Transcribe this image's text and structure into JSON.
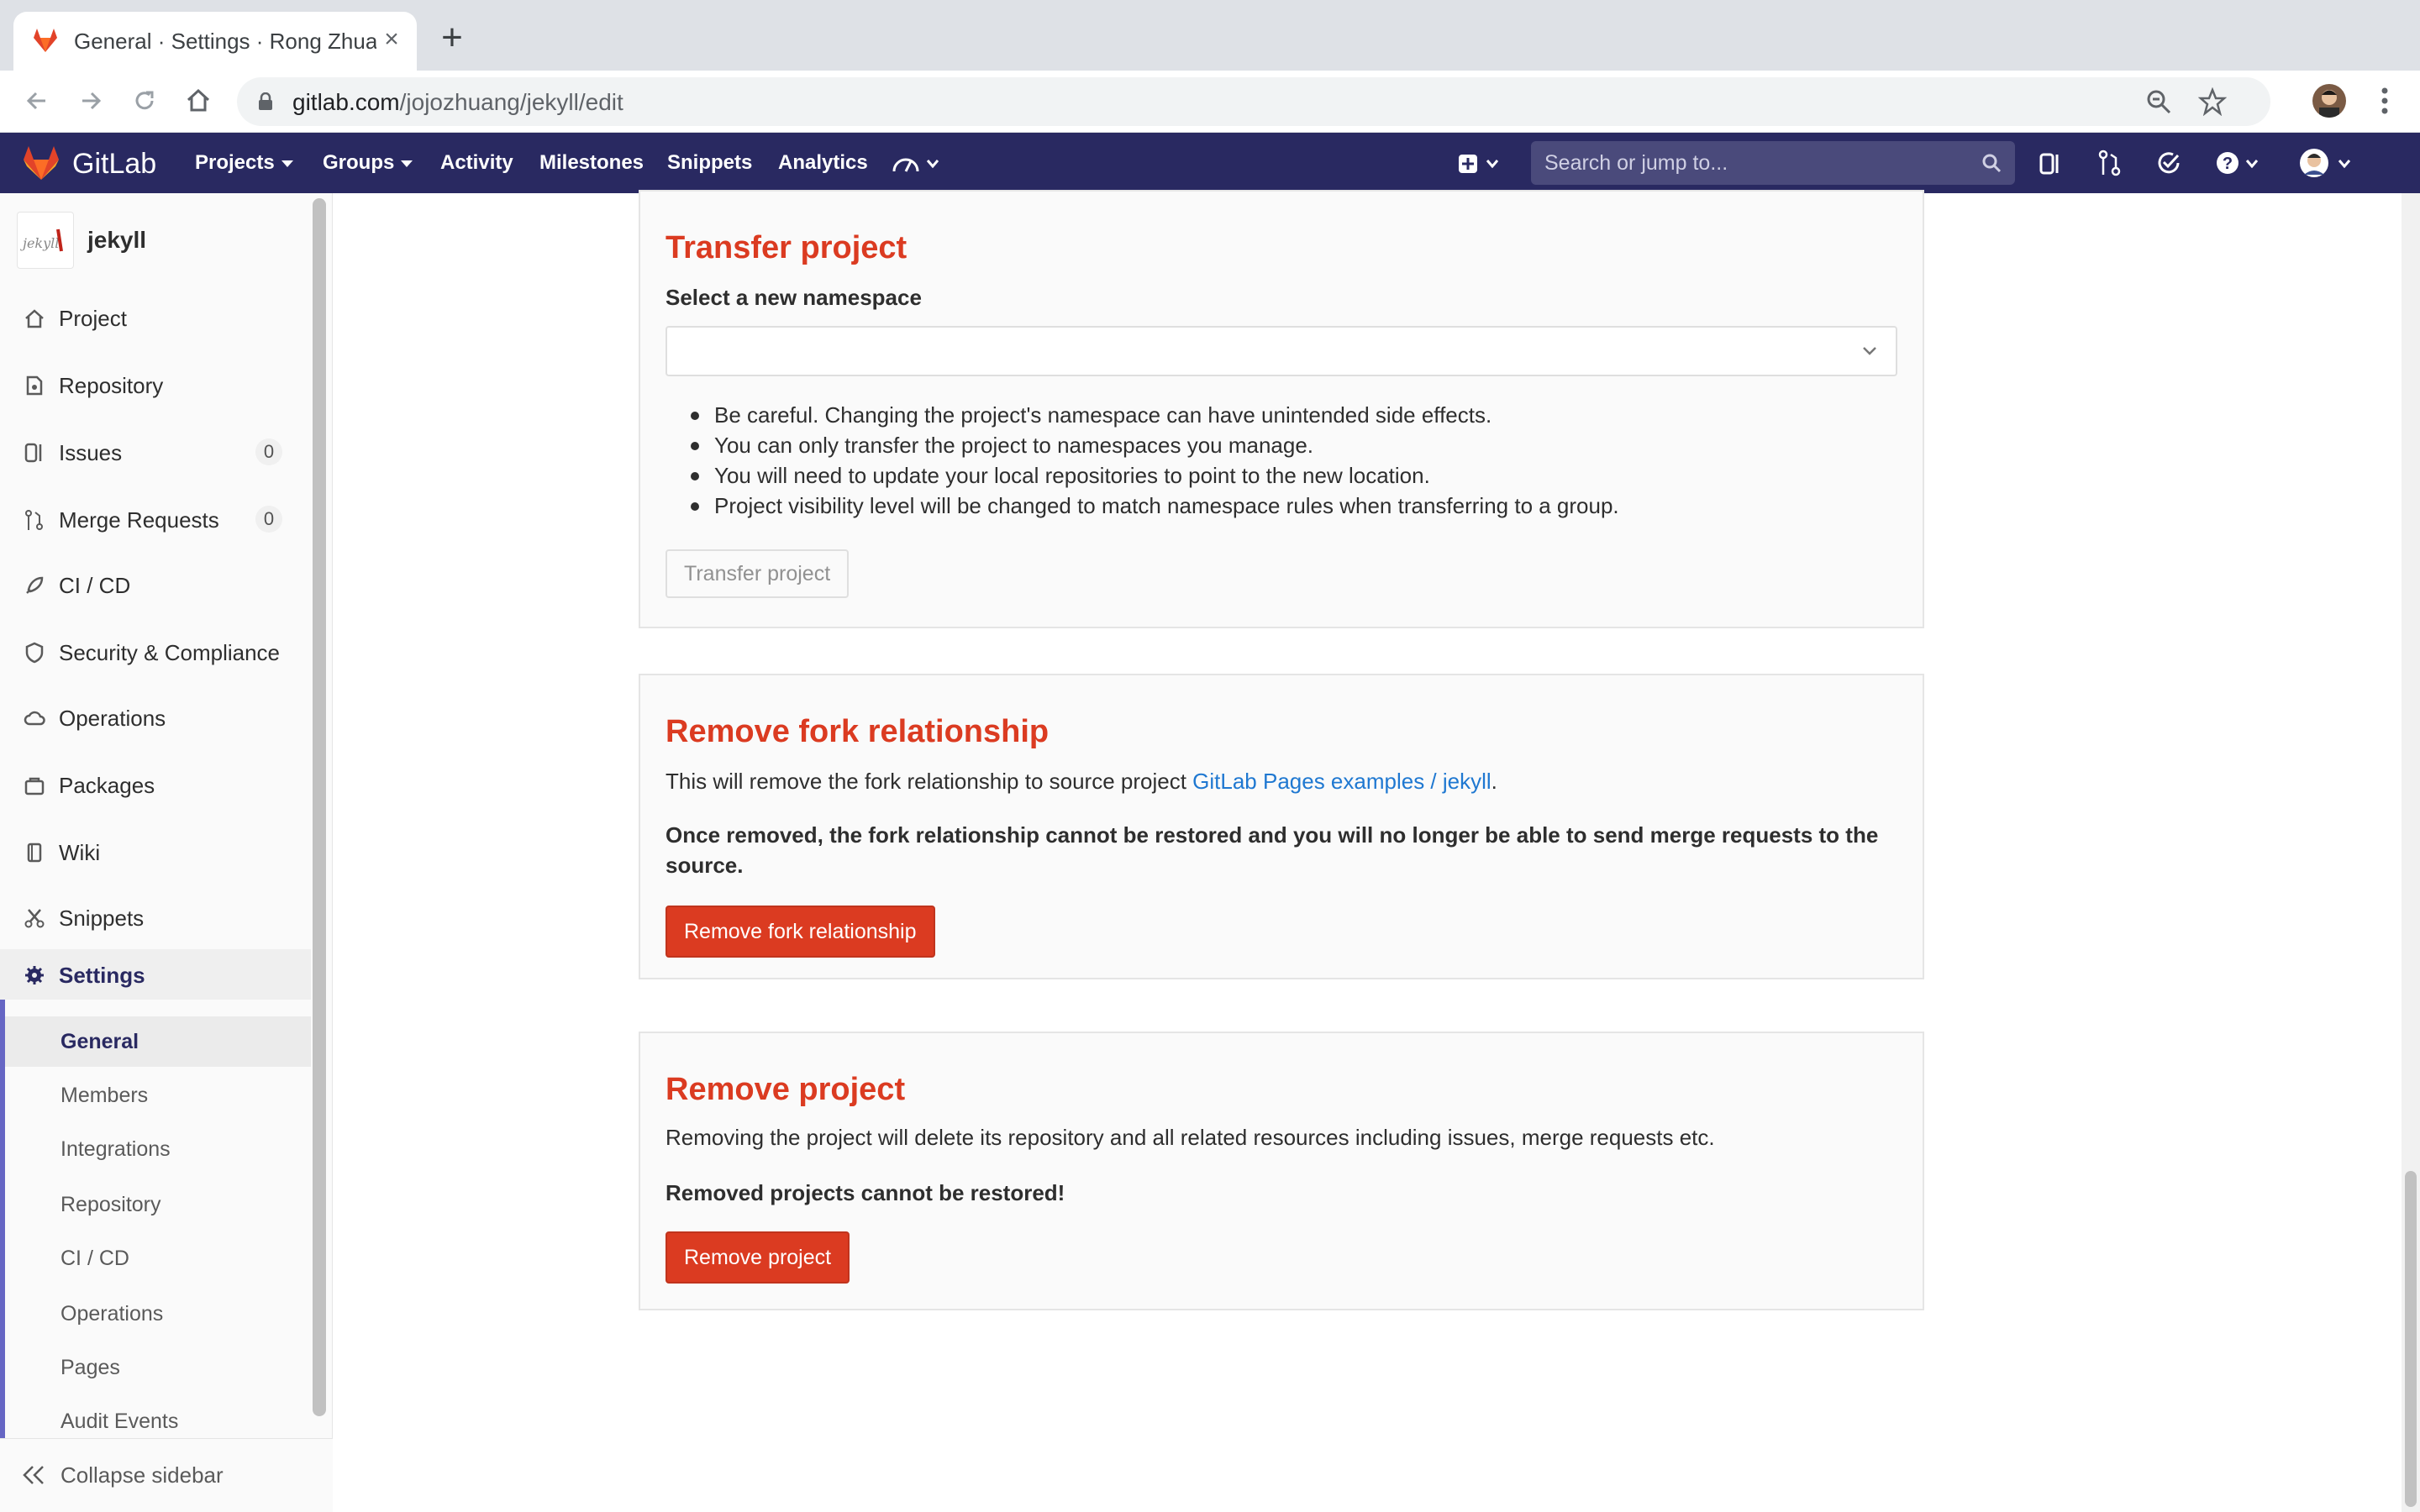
{
  "browser": {
    "tab_title": "General · Settings · Rong Zhuang",
    "url_host": "gitlab.com",
    "url_path": "/jojozhuang/jekyll/edit"
  },
  "gitlab_nav": {
    "brand": "GitLab",
    "links": [
      "Projects",
      "Groups",
      "Activity",
      "Milestones",
      "Snippets",
      "Analytics"
    ],
    "search_placeholder": "Search or jump to..."
  },
  "sidebar": {
    "project_name": "jekyll",
    "items": [
      {
        "label": "Project",
        "icon": "home-icon"
      },
      {
        "label": "Repository",
        "icon": "doc-icon"
      },
      {
        "label": "Issues",
        "icon": "issues-icon",
        "count": "0"
      },
      {
        "label": "Merge Requests",
        "icon": "merge-request-icon",
        "count": "0"
      },
      {
        "label": "CI / CD",
        "icon": "rocket-icon"
      },
      {
        "label": "Security & Compliance",
        "icon": "shield-icon"
      },
      {
        "label": "Operations",
        "icon": "cloud-icon"
      },
      {
        "label": "Packages",
        "icon": "package-icon"
      },
      {
        "label": "Wiki",
        "icon": "book-icon"
      },
      {
        "label": "Snippets",
        "icon": "scissors-icon"
      },
      {
        "label": "Settings",
        "icon": "gear-icon"
      }
    ],
    "settings_sub": [
      "General",
      "Members",
      "Integrations",
      "Repository",
      "CI / CD",
      "Operations",
      "Pages",
      "Audit Events"
    ],
    "active_sub": "General",
    "collapse_label": "Collapse sidebar"
  },
  "transfer": {
    "title": "Transfer project",
    "label": "Select a new namespace",
    "bullets": [
      "Be careful. Changing the project's namespace can have unintended side effects.",
      "You can only transfer the project to namespaces you manage.",
      "You will need to update your local repositories to point to the new location.",
      "Project visibility level will be changed to match namespace rules when transferring to a group."
    ],
    "button": "Transfer project"
  },
  "fork": {
    "title": "Remove fork relationship",
    "text_before": "This will remove the fork relationship to source project ",
    "link": "GitLab Pages examples / jekyll",
    "text_after": ".",
    "warning": "Once removed, the fork relationship cannot be restored and you will no longer be able to send merge requests to the source.",
    "button": "Remove fork relationship"
  },
  "remove": {
    "title": "Remove project",
    "text": "Removing the project will delete its repository and all related resources including issues, merge requests etc.",
    "warning": "Removed projects cannot be restored!",
    "button": "Remove project"
  },
  "colors": {
    "nav_bg": "#292961",
    "danger": "#db3b21",
    "link": "#1f78d1",
    "active_sidebar": "#6666c4"
  }
}
